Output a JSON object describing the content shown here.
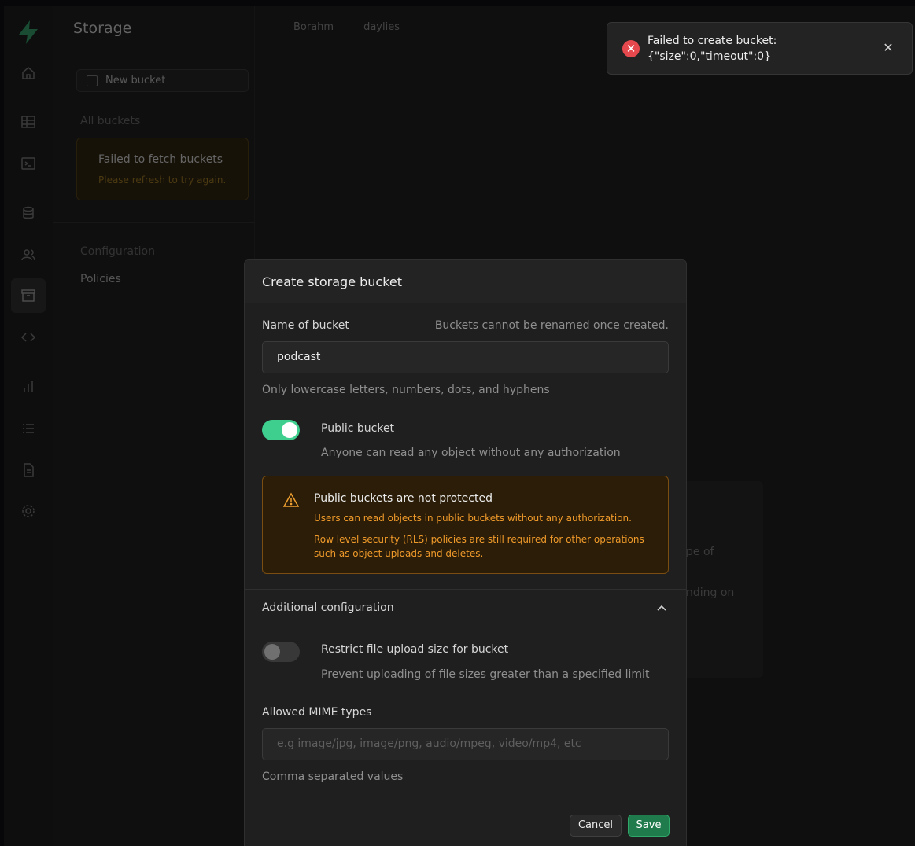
{
  "app": {
    "page_title": "Storage",
    "breadcrumbs": [
      "Borahm",
      "daylies"
    ]
  },
  "menu": {
    "new_bucket_label": "New bucket",
    "all_buckets_label": "All buckets",
    "fetch_error_title": "Failed to fetch buckets",
    "fetch_error_hint": "Please refresh to try again.",
    "configuration_label": "Configuration",
    "policies_label": "Policies"
  },
  "background_fragments": [
    "pe of",
    "nding on"
  ],
  "toast": {
    "message_line1": "Failed to create bucket:",
    "message_line2": "{\"size\":0,\"timeout\":0}",
    "close_label": "✕",
    "error_icon": "✕"
  },
  "modal": {
    "title": "Create storage bucket",
    "name_label": "Name of bucket",
    "name_note": "Buckets cannot be renamed once created.",
    "name_value": "podcast",
    "name_hint": "Only lowercase letters, numbers, dots, and hyphens",
    "public": {
      "label": "Public bucket",
      "description": "Anyone can read any object without any authorization",
      "enabled": true
    },
    "warning": {
      "title": "Public buckets are not protected",
      "line1": "Users can read objects in public buckets without any authorization.",
      "line2": "Row level security (RLS) policies are still required for other operations such as object uploads and deletes."
    },
    "additional_config_label": "Additional configuration",
    "restrict": {
      "label": "Restrict file upload size for bucket",
      "description": "Prevent uploading of file sizes greater than a specified limit",
      "enabled": false
    },
    "mime_label": "Allowed MIME types",
    "mime_placeholder": "e.g image/jpg, image/png, audio/mpeg, video/mp4, etc",
    "mime_hint": "Comma separated values",
    "cancel_label": "Cancel",
    "save_label": "Save"
  },
  "colors": {
    "accent": "#3ecf8e",
    "error": "#e5484d",
    "warning": "#f09a2a"
  }
}
